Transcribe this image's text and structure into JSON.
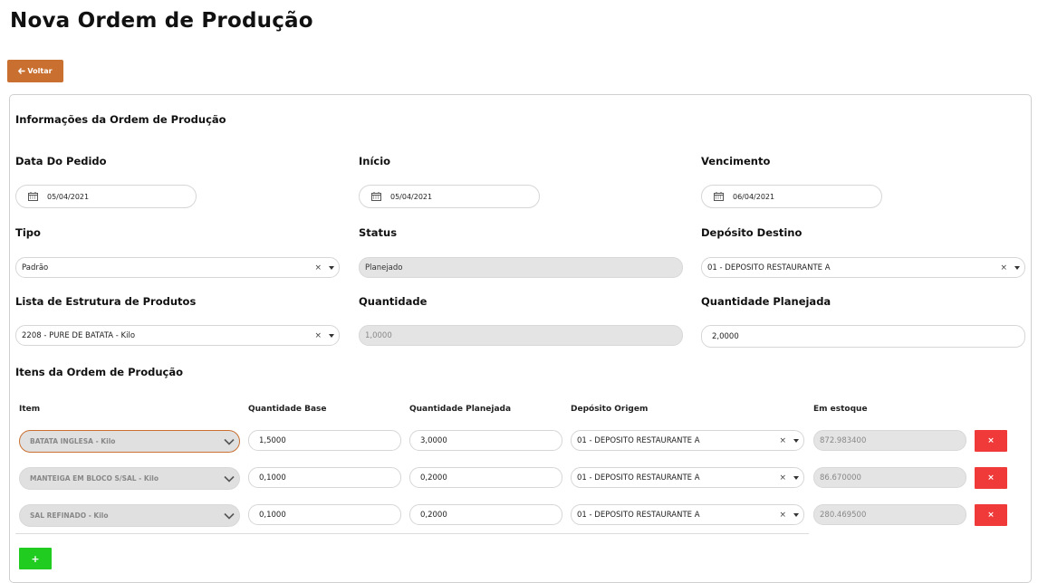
{
  "page": {
    "title": "Nova Ordem de Produção"
  },
  "toolbar": {
    "back_label": "Voltar",
    "back_icon": "arrow-left-icon"
  },
  "section_info": {
    "title": "Informações da Ordem de Produção"
  },
  "fields": {
    "data_pedido": {
      "label": "Data Do Pedido",
      "value": "05/04/2021"
    },
    "inicio": {
      "label": "Início",
      "value": "05/04/2021"
    },
    "vencimento": {
      "label": "Vencimento",
      "value": "06/04/2021"
    },
    "tipo": {
      "label": "Tipo",
      "value": "Padrão"
    },
    "status": {
      "label": "Status",
      "value": "Planejado"
    },
    "deposito_destino": {
      "label": "Depósito Destino",
      "value": "01 - DEPÓSITO RESTAURANTE A"
    },
    "lista_estrutura": {
      "label": "Lista de Estrutura de Produtos",
      "value": "2208 - PURE DE BATATA - Kilo"
    },
    "quantidade": {
      "label": "Quantidade",
      "value": "1,0000"
    },
    "quantidade_planejada": {
      "label": "Quantidade Planejada",
      "value": "2,0000"
    }
  },
  "section_items": {
    "title": "Itens da Ordem de Produção",
    "columns": {
      "item": "Item",
      "qtd_base": "Quantidade Base",
      "qtd_planejada": "Quantidade Planejada",
      "deposito_origem": "Depósito Origem",
      "em_estoque": "Em estoque"
    },
    "rows": [
      {
        "item": "BATATA INGLESA - Kilo",
        "qtd_base": "1,5000",
        "qtd_planejada": "3,0000",
        "deposito": "01 - DEPÓSITO RESTAURANTE A",
        "estoque": "872.983400"
      },
      {
        "item": "MANTEIGA EM BLOCO S/SAL - Kilo",
        "qtd_base": "0,1000",
        "qtd_planejada": "0,2000",
        "deposito": "01 - DEPÓSITO RESTAURANTE A",
        "estoque": "86.670000"
      },
      {
        "item": "SAL REFINADO - Kilo",
        "qtd_base": "0,1000",
        "qtd_planejada": "0,2000",
        "deposito": "01 - DEPÓSITO RESTAURANTE A",
        "estoque": "280.469500"
      }
    ],
    "delete_label": "×",
    "add_label": "+"
  },
  "glyphs": {
    "clear": "×"
  },
  "colors": {
    "accent": "#c97031",
    "danger": "#f03a3a",
    "success": "#1fcc1f"
  }
}
